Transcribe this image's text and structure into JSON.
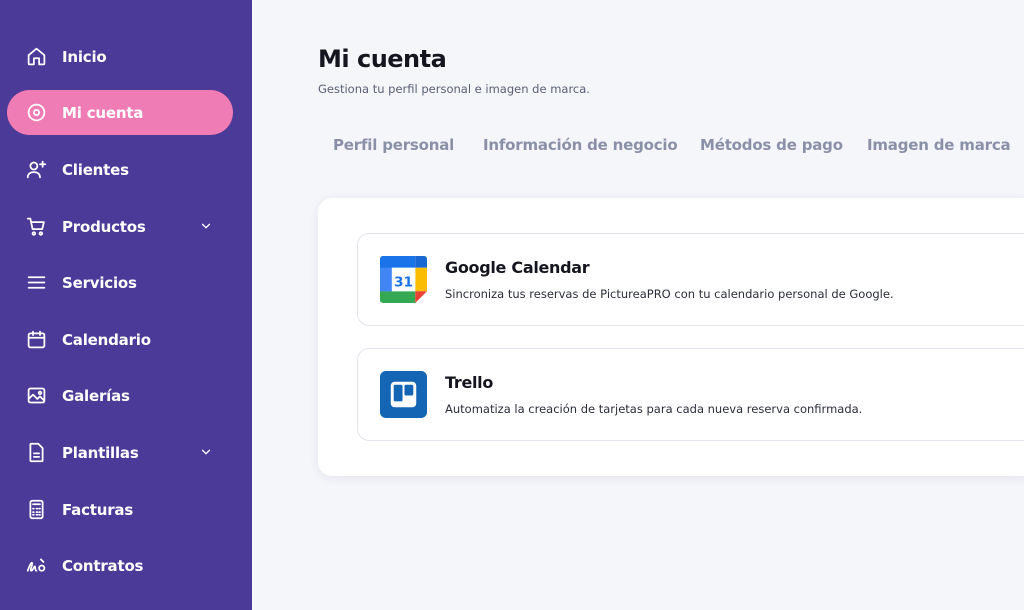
{
  "sidebar": {
    "items": [
      {
        "label": "Inicio",
        "icon": "home-icon"
      },
      {
        "label": "Mi cuenta",
        "icon": "account-circle-icon",
        "active": true
      },
      {
        "label": "Clientes",
        "icon": "user-plus-icon"
      },
      {
        "label": "Productos",
        "icon": "cart-icon",
        "has_submenu": true
      },
      {
        "label": "Servicios",
        "icon": "menu-lines-icon"
      },
      {
        "label": "Calendario",
        "icon": "calendar-icon"
      },
      {
        "label": "Galerías",
        "icon": "image-icon"
      },
      {
        "label": "Plantillas",
        "icon": "file-icon",
        "has_submenu": true
      },
      {
        "label": "Facturas",
        "icon": "calculator-icon"
      },
      {
        "label": "Contratos",
        "icon": "signature-icon"
      }
    ],
    "bg_color": "#4b3a98",
    "active_color": "#f07cb5"
  },
  "main": {
    "title": "Mi cuenta",
    "subtitle": "Gestiona tu perfil personal e imagen de marca.",
    "tabs": [
      {
        "label": "Perfil personal"
      },
      {
        "label": "Información de negocio"
      },
      {
        "label": "Métodos de pago"
      },
      {
        "label": "Imagen de marca"
      }
    ],
    "integrations": [
      {
        "name": "Google Calendar",
        "description": "Sincroniza tus reservas de PictureaPRO con tu calendario personal de Google.",
        "logo": "google-calendar-logo",
        "logo_text": "31"
      },
      {
        "name": "Trello",
        "description": "Automatiza la creación de tarjetas para cada nueva reserva confirmada.",
        "logo": "trello-logo"
      }
    ]
  }
}
